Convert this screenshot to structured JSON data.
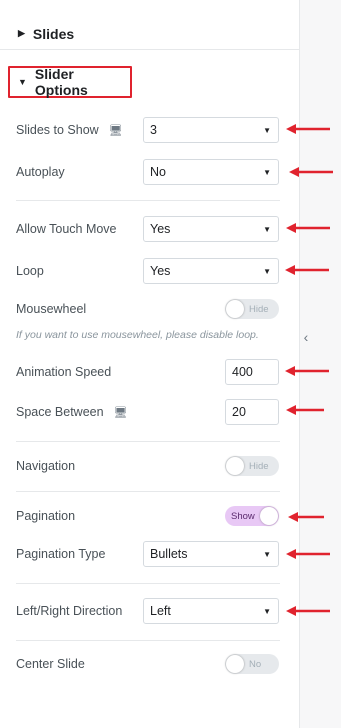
{
  "sections": {
    "slides_title": "Slides",
    "slider_options_title": "Slider Options"
  },
  "controls": {
    "slides_to_show": {
      "label": "Slides to Show",
      "value": "3"
    },
    "autoplay": {
      "label": "Autoplay",
      "value": "No"
    },
    "allow_touch_move": {
      "label": "Allow Touch Move",
      "value": "Yes"
    },
    "loop": {
      "label": "Loop",
      "value": "Yes"
    },
    "mousewheel": {
      "label": "Mousewheel",
      "toggle_text": "Hide",
      "enabled": false
    },
    "mousewheel_note": "If you want to use mousewheel, please disable loop.",
    "animation_speed": {
      "label": "Animation Speed",
      "value": "400"
    },
    "space_between": {
      "label": "Space Between",
      "value": "20"
    },
    "navigation": {
      "label": "Navigation",
      "toggle_text": "Hide",
      "enabled": false
    },
    "pagination": {
      "label": "Pagination",
      "toggle_text": "Show",
      "enabled": true
    },
    "pagination_type": {
      "label": "Pagination Type",
      "value": "Bullets"
    },
    "direction": {
      "label": "Left/Right Direction",
      "value": "Left"
    },
    "center_slide": {
      "label": "Center Slide",
      "toggle_text": "No",
      "enabled": false
    }
  },
  "icons": {
    "caret": "caret-down-icon",
    "responsive": "desktop-monitor-icon",
    "collapse": "chevron-left-icon",
    "annotation": "red-arrow-icon"
  },
  "colors": {
    "highlight": "#e0232e",
    "toggle_on": "#e8c8f5",
    "toggle_off": "#e6e9ec"
  }
}
